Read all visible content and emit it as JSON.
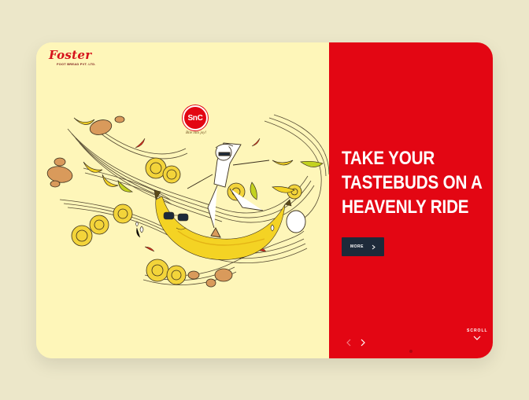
{
  "brand": {
    "logo_text": "Foster",
    "logo_subtext": "FOOT BREAD PVT. LTD.",
    "badge_text": "SnC",
    "tagline": "Bite into joy!"
  },
  "hero": {
    "headline_line1": "TAKE YOUR",
    "headline_line2": "TASTEBUDS ON A",
    "headline_line3": "HEAVENLY RIDE",
    "more_label": "MORE"
  },
  "navigation": {
    "prev_icon": "chevron-left-icon",
    "next_icon": "chevron-right-icon",
    "scroll_label": "SCROLL",
    "scroll_icon": "chevron-down-icon"
  },
  "colors": {
    "page_bg": "#ece7c9",
    "panel_left": "#fef6b9",
    "panel_right": "#e30613",
    "button_bg": "#1d2a3a",
    "banana": "#f4d324",
    "chips": "#f3d43a",
    "green_banana": "#c3d21f",
    "potato": "#d99a5b",
    "chili": "#d42a1a"
  }
}
